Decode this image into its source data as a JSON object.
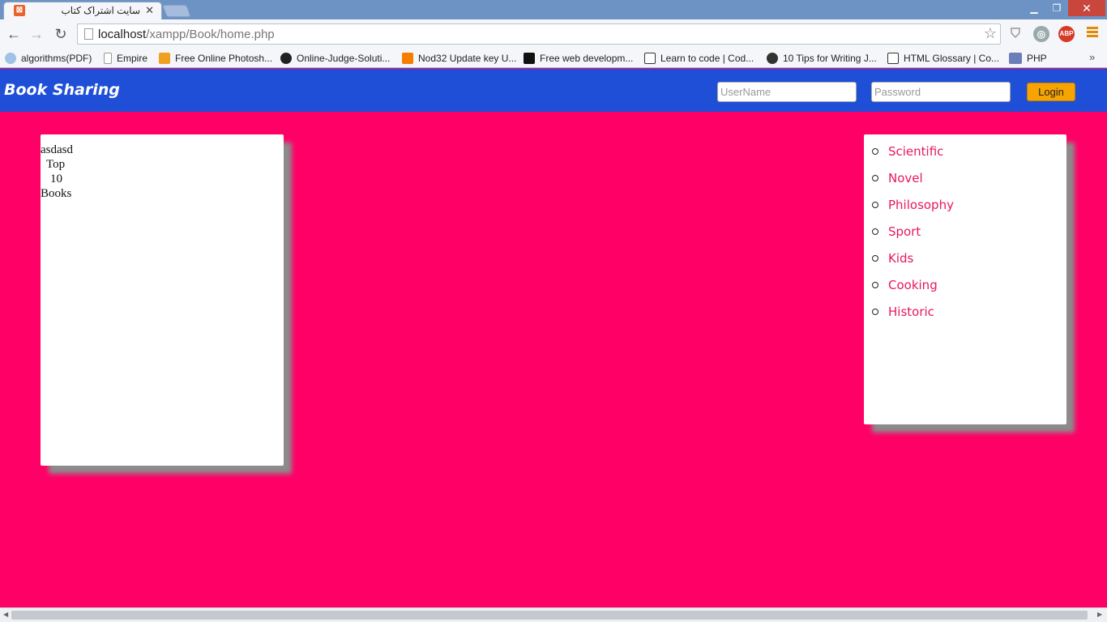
{
  "browser": {
    "tab_title": "سایت اشتراک کتاب",
    "url_host": "localhost",
    "url_path": "/xampp/Book/home.php",
    "bookmarks": [
      {
        "label": "algorithms(PDF)",
        "icon": "cloud-icon",
        "color": "#9ec3e6"
      },
      {
        "label": "Empire",
        "icon": "page-icon",
        "color": "#ffffff"
      },
      {
        "label": "Free Online Photosh...",
        "icon": "photo-icon",
        "color": "#f0a020"
      },
      {
        "label": "Online-Judge-Soluti...",
        "icon": "github-icon",
        "color": "#222222"
      },
      {
        "label": "Nod32 Update key U...",
        "icon": "blogger-icon",
        "color": "#f57d00"
      },
      {
        "label": "Free web developm...",
        "icon": "p-icon",
        "color": "#111111"
      },
      {
        "label": "Learn to code | Cod...",
        "icon": "codecademy-icon",
        "color": "#ffffff"
      },
      {
        "label": "10 Tips for Writing J...",
        "icon": "tips-icon",
        "color": "#333333"
      },
      {
        "label": "HTML Glossary | Co...",
        "icon": "codecademy-icon",
        "color": "#ffffff"
      },
      {
        "label": "PHP",
        "icon": "php-icon",
        "color": "#6c7eb7"
      }
    ]
  },
  "header": {
    "brand": "Book Sharing",
    "username_placeholder": "UserName",
    "password_placeholder": "Password",
    "login_label": "Login"
  },
  "left_panel": {
    "lines": [
      "asdasd",
      "Top",
      "10",
      "Books"
    ]
  },
  "categories": [
    "Scientific",
    "Novel",
    "Philosophy",
    "Sport",
    "Kids",
    "Cooking",
    "Historic"
  ],
  "colors": {
    "page_bg": "#ff0066",
    "header_bg": "#1e4fd6",
    "login_button": "#f7a300",
    "category_text": "#e8175d"
  }
}
